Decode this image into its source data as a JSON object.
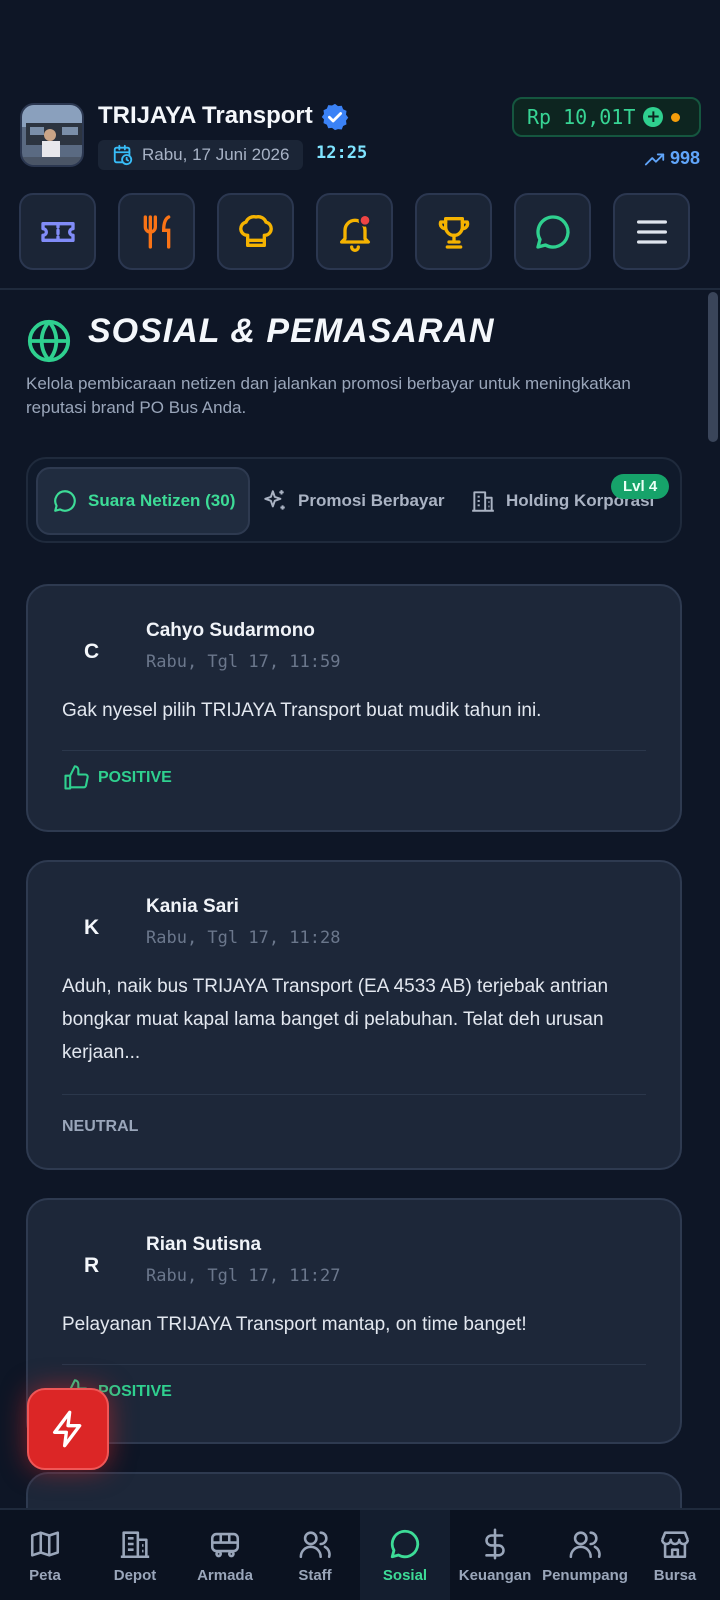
{
  "header": {
    "company_name": "TRIJAYA Transport",
    "date": "Rabu, 17 Juni 2026",
    "time": "12:25",
    "balance": "Rp 10,01T",
    "balance_add": "+",
    "reputation": "998"
  },
  "quick_actions": [
    {
      "icon": "ticket-icon",
      "color": "#818cf8"
    },
    {
      "icon": "utensils-icon",
      "color": "#f97316"
    },
    {
      "icon": "chef-hat-icon",
      "color": "#f5b301"
    },
    {
      "icon": "bell-icon",
      "color": "#f5b301",
      "badge": true
    },
    {
      "icon": "trophy-icon",
      "color": "#f5b301"
    },
    {
      "icon": "chat-icon",
      "color": "#2fd08f"
    },
    {
      "icon": "menu-icon",
      "color": "#dfe5ee"
    }
  ],
  "section": {
    "title": "SOSIAL & PEMASARAN",
    "description": "Kelola pembicaraan netizen dan jalankan promosi berbayar untuk meningkatkan reputasi brand PO Bus Anda."
  },
  "tabs": [
    {
      "label": "Suara Netizen (30)",
      "active": true
    },
    {
      "label": "Promosi Berbayar",
      "active": false
    },
    {
      "label": "Holding Korporasi",
      "active": false,
      "badge": "Lvl 4"
    }
  ],
  "posts": [
    {
      "initial": "C",
      "name": "Cahyo Sudarmono",
      "timestamp": "Rabu, Tgl 17, 11:59",
      "message": "Gak nyesel pilih TRIJAYA Transport buat mudik tahun ini.",
      "sentiment": "POSITIVE"
    },
    {
      "initial": "K",
      "name": "Kania Sari",
      "timestamp": "Rabu, Tgl 17, 11:28",
      "message": "Aduh, naik bus TRIJAYA Transport (EA 4533 AB) terjebak antrian bongkar muat kapal lama banget di pelabuhan. Telat deh urusan kerjaan...",
      "sentiment": "NEUTRAL"
    },
    {
      "initial": "R",
      "name": "Rian Sutisna",
      "timestamp": "Rabu, Tgl 17, 11:27",
      "message": "Pelayanan TRIJAYA Transport mantap, on time banget!",
      "sentiment": "POSITIVE"
    }
  ],
  "bottom_nav": [
    {
      "label": "Peta",
      "icon": "map-icon"
    },
    {
      "label": "Depot",
      "icon": "building-icon"
    },
    {
      "label": "Armada",
      "icon": "bus-icon"
    },
    {
      "label": "Staff",
      "icon": "users-icon"
    },
    {
      "label": "Sosial",
      "icon": "chat-icon",
      "active": true
    },
    {
      "label": "Keuangan",
      "icon": "dollar-icon"
    },
    {
      "label": "Penumpang",
      "icon": "passengers-icon"
    },
    {
      "label": "Bursa",
      "icon": "store-icon"
    }
  ]
}
